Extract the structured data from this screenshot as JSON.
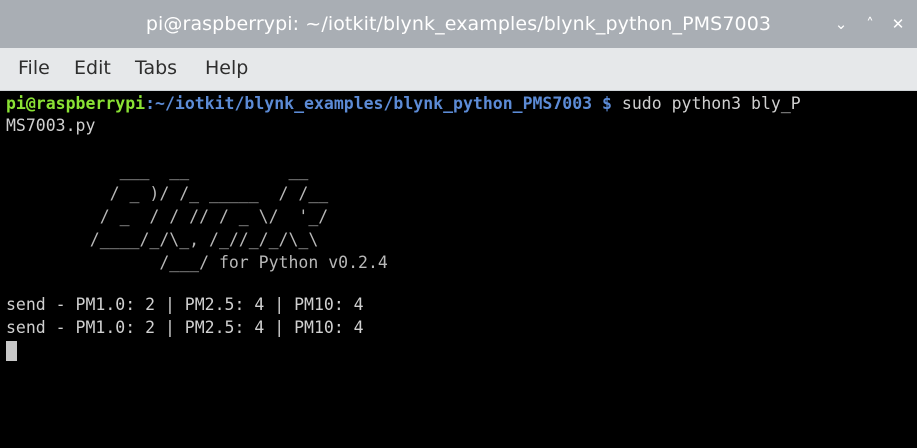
{
  "window": {
    "title": "pi@raspberrypi: ~/iotkit/blynk_examples/blynk_python_PMS7003",
    "controls": [
      "⌄",
      "˄",
      "✕"
    ]
  },
  "menu": [
    "File",
    "Edit",
    "Tabs",
    "Help"
  ],
  "terminal": {
    "prompt_user": "pi@raspberrypi",
    "prompt_path": ":~/iotkit/blynk_examples/blynk_python_PMS7003 $",
    "command_part1": " sudo python3 bly_P",
    "command_part2": "MS7003.py",
    "banner": [
      "      ___  __          __",
      "     / _ )/ /_ _____  / /__",
      "    / _  / / // / _ \\/  '_/",
      "   /____/_/\\_, /_//_/_/\\_\\",
      "          /___/ for Python v0.2.4"
    ],
    "output": [
      "send - PM1.0: 2 | PM2.5: 4 | PM10: 4",
      "send - PM1.0: 2 | PM2.5: 4 | PM10: 4"
    ]
  }
}
